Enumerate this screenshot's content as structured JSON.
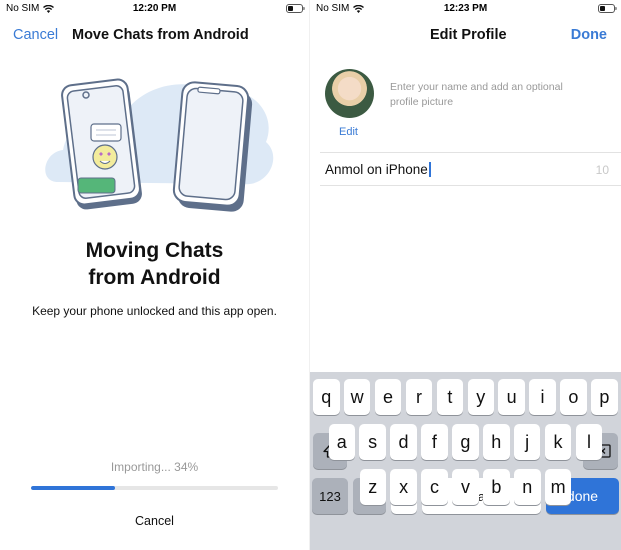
{
  "left": {
    "status": {
      "carrier": "No SIM",
      "time": "12:20 PM",
      "battery_level": "low"
    },
    "nav": {
      "cancel_label": "Cancel",
      "title": "Move Chats from Android"
    },
    "heading_line1": "Moving Chats",
    "heading_line2": "from Android",
    "subtext": "Keep your phone unlocked and this app open.",
    "progress": {
      "label": "Importing... 34%",
      "percent": 34
    },
    "cancel_label": "Cancel",
    "colors": {
      "accent": "#3a7bd5",
      "progress": "#2f74d8"
    }
  },
  "right": {
    "status": {
      "carrier": "No SIM",
      "time": "12:23 PM",
      "battery_level": "low"
    },
    "nav": {
      "title": "Edit Profile",
      "done_label": "Done"
    },
    "profile": {
      "hint": "Enter your name and add an optional profile picture",
      "edit_label": "Edit",
      "name_value": "Anmol on iPhone",
      "remaining_chars": "10"
    },
    "keyboard": {
      "row1": [
        "q",
        "w",
        "e",
        "r",
        "t",
        "y",
        "u",
        "i",
        "o",
        "p"
      ],
      "row2": [
        "a",
        "s",
        "d",
        "f",
        "g",
        "h",
        "j",
        "k",
        "l"
      ],
      "row3": [
        "z",
        "x",
        "c",
        "v",
        "b",
        "n",
        "m"
      ],
      "numbers_label": "123",
      "space_label": "space",
      "done_label": "done"
    }
  }
}
